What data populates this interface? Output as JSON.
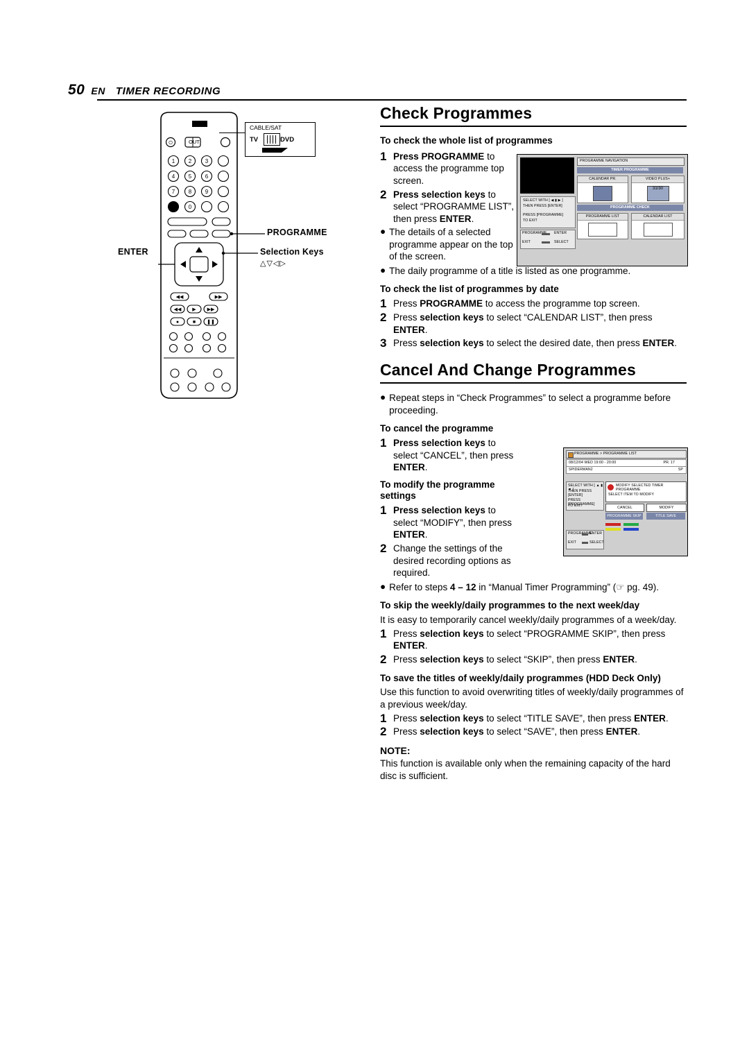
{
  "header": {
    "page_number": "50",
    "lang": "EN",
    "section": "TIMER RECORDING"
  },
  "remote": {
    "cable_sat_label": "CABLE/SAT",
    "out_label": "OUT",
    "tv_label": "TV",
    "dvd_label": "DVD",
    "programme_label": "PROGRAMME",
    "enter_label": "ENTER",
    "selection_keys_label": "Selection Keys",
    "selection_keys_glyphs": "△▽◁▷",
    "numbers": [
      "1",
      "2",
      "3",
      "4",
      "5",
      "6",
      "7",
      "8",
      "9",
      "0"
    ]
  },
  "sections": {
    "check": {
      "title": "Check Programmes",
      "sub1": "To check the whole list of programmes",
      "s1_num": "1",
      "s1_text_bold": "Press PROGRAMME",
      "s1_text_rest": "to access the programme top screen.",
      "s2_num": "2",
      "s2_b1": "Press selection keys",
      "s2_rest": "to select “PROGRAMME LIST”, then press ",
      "s2_b2": "ENTER",
      "s2_end": ".",
      "b1": "The details of a selected programme appear on the top of the screen.",
      "b2": "The daily programme of a title is listed as one programme.",
      "sub2": "To check the list of programmes by date",
      "d1_num": "1",
      "d1_a": "Press ",
      "d1_b": "PROGRAMME",
      "d1_c": " to access the programme top screen.",
      "d2_num": "2",
      "d2_a": "Press ",
      "d2_b": "selection keys",
      "d2_c": " to select “CALENDAR LIST”, then press ",
      "d2_d": "ENTER",
      "d2_e": ".",
      "d3_num": "3",
      "d3_a": "Press ",
      "d3_b": "selection keys",
      "d3_c": " to select the desired date, then press ",
      "d3_d": "ENTER",
      "d3_e": "."
    },
    "cancel": {
      "title": "Cancel And Change Programmes",
      "b1": "Repeat steps in “Check Programmes” to select a programme before proceeding.",
      "sub1": "To cancel the programme",
      "c1_num": "1",
      "c1_b": "Press selection keys",
      "c1_rest": "to select “CANCEL”, then press ",
      "c1_b2": "ENTER",
      "c1_end": ".",
      "sub2": "To modify the programme settings",
      "m1_num": "1",
      "m1_b": "Press selection keys",
      "m1_rest": "to select “MODIFY”, then press ",
      "m1_b2": "ENTER",
      "m1_end": ".",
      "m2_num": "2",
      "m2_text": "Change the settings of the desired recording options as required.",
      "m_bullet_a": "Refer to steps ",
      "m_bullet_b": "4 – 12",
      "m_bullet_c": " in “Manual Timer Programming” (",
      "m_bullet_icon": "☞",
      "m_bullet_d": " pg. 49).",
      "sub3": "To skip the weekly/daily programmes to the next week/day",
      "skip_text": "It is easy to temporarily cancel weekly/daily programmes of a week/day.",
      "k1_num": "1",
      "k1_a": "Press ",
      "k1_b": "selection keys",
      "k1_c": " to select “PROGRAMME SKIP”, then press ",
      "k1_d": "ENTER",
      "k1_e": ".",
      "k2_num": "2",
      "k2_a": "Press ",
      "k2_b": "selection keys",
      "k2_c": " to select “SKIP”, then press ",
      "k2_d": "ENTER",
      "k2_e": ".",
      "sub4": "To save the titles of weekly/daily programmes (HDD Deck Only)",
      "save_text": "Use this function to avoid overwriting titles of weekly/daily programmes of a previous week/day.",
      "v1_num": "1",
      "v1_a": "Press ",
      "v1_b": "selection keys",
      "v1_c": " to select “TITLE SAVE”, then press ",
      "v1_d": "ENTER",
      "v1_e": ".",
      "v2_num": "2",
      "v2_a": "Press ",
      "v2_b": "selection keys",
      "v2_c": " to select “SAVE”, then press ",
      "v2_d": "ENTER",
      "v2_e": ".",
      "note_h": "NOTE:",
      "note_text": "This function is available only when the remaining capacity of the hard disc is sufficient."
    }
  },
  "osd1": {
    "title": "PROGRAMME NAVIGATION",
    "bar1": "TIMER PROGRAMME",
    "left1": "SELECT WITH [ ◀ ▮ ▶ ]",
    "left2": "THEN PRESS [ENTER]",
    "left3": "PRESS [PROGRAMME]",
    "left4": "TO EXIT",
    "left5": "PROGRAMME",
    "left6": "ENTER",
    "left7": "EXIT",
    "left8": "SELECT",
    "cell1": "CALENDAR PR.",
    "cell2": "VIDEO PLUS+",
    "bar2": "PROGRAMME CHECK",
    "cell3": "PROGRAMME LIST",
    "cell4": "CALENDAR LIST"
  },
  "osd2": {
    "title": "PROGRAMME > PROGRAMME LIST",
    "row_date": "08/12/04 WED 19:00 - 20:00",
    "row_pr": "PR. 17",
    "row_title": "SPIDERMAN2",
    "row_sp": "SP",
    "left1": "SELECT WITH [ ▲ ▮ ▼ ]",
    "left2": "THEN PRESS [ENTER]",
    "left3": "PRESS [PROGRAMME]",
    "left4": "TO EXIT",
    "left5": "PROGRAMME",
    "left6": "ENTER",
    "left7": "EXIT",
    "left8": "SELECT",
    "dlg1": "MODIFY SELECTED TIMER PROGRAMME",
    "dlg2": "SELECT ITEM TO MODIFY",
    "btn_cancel": "CANCEL",
    "btn_modify": "MODIFY",
    "btn_skip": "PROGRAMME SKIP",
    "btn_save": "TITLE SAVE"
  }
}
